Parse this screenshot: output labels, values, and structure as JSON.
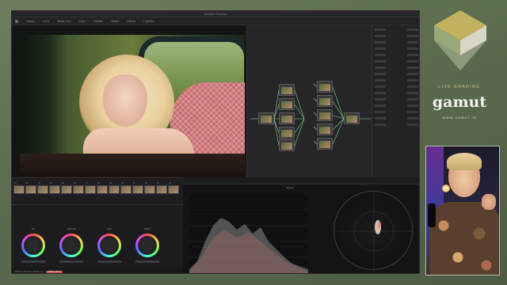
{
  "window": {
    "title": "DaVinci Resolve",
    "toolbar_items": [
      "Gallery",
      "LUTs",
      "Media Pool",
      "Clips",
      "Timeline",
      "Nodes",
      "Effects",
      "Lightbox"
    ]
  },
  "gallery": {
    "clip_numbers": [
      "01",
      "02",
      "03",
      "04",
      "05",
      "06",
      "07",
      "08",
      "09",
      "10",
      "11",
      "12",
      "13",
      "14"
    ]
  },
  "wheels": {
    "labels": [
      "Lift",
      "Gamma",
      "Gain",
      "Offset"
    ]
  },
  "scopes": {
    "title": "Scopes"
  },
  "status": {
    "app_name": "DaVinci Resolve Studio 18",
    "badge": "PUBLIC BETA"
  },
  "branding": {
    "tagline": "LIVE GRADING",
    "name": "gamut",
    "website": "WWW.GAMUT.IO",
    "logo_colors": [
      "#c2b15e",
      "#98a878",
      "#8a9a7a",
      "#d9d6c8"
    ]
  }
}
